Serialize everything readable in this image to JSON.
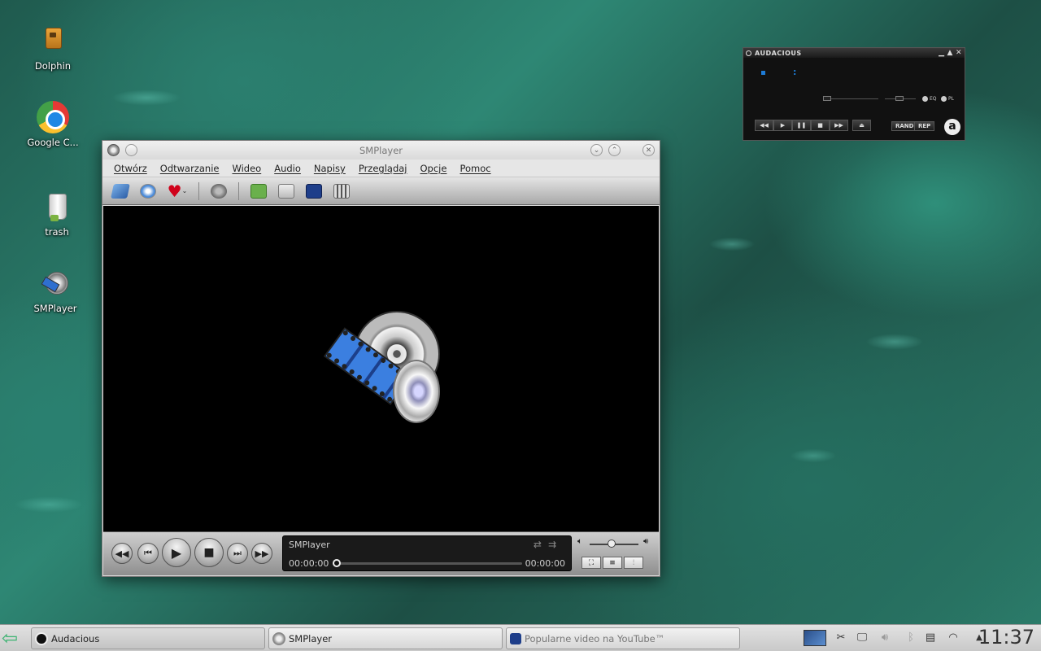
{
  "desktop": {
    "icons": [
      {
        "label": "Dolphin",
        "icon": "dolphin-icon"
      },
      {
        "label": "Google C...",
        "icon": "chrome-icon"
      },
      {
        "label": "trash",
        "icon": "trash-icon"
      },
      {
        "label": "SMPlayer",
        "icon": "smplayer-icon"
      }
    ]
  },
  "audacious": {
    "title": "AUDACIOUS",
    "time_colon": ":",
    "buttons": {
      "rew": "◀◀",
      "play": "▶",
      "pause": "❚❚",
      "stop": "■",
      "fwd": "▶▶",
      "eject": "⏏"
    },
    "rand": "RAND",
    "rep": "REP",
    "eq": "EQ",
    "pl": "PL",
    "logo": "a"
  },
  "smplayer": {
    "title": "SMPlayer",
    "menu": [
      "Otwórz",
      "Odtwarzanie",
      "Wideo",
      "Audio",
      "Napisy",
      "Przeglądaj",
      "Opcje",
      "Pomoc"
    ],
    "now_playing": "SMPlayer",
    "time_current": "00:00:00",
    "time_total": "00:00:00",
    "progress": 0,
    "volume": 0.45
  },
  "taskbar": {
    "tasks": [
      {
        "label": "Audacious",
        "icon": "audacious-icon"
      },
      {
        "label": "SMPlayer",
        "icon": "smplayer-icon"
      },
      {
        "label": "Popularne video na YouTube™",
        "icon": "smplayer-icon"
      }
    ],
    "clock": "11:37"
  },
  "colors": {
    "accent": "#1e7bd6",
    "lcd_bg": "#1a1a1a"
  }
}
